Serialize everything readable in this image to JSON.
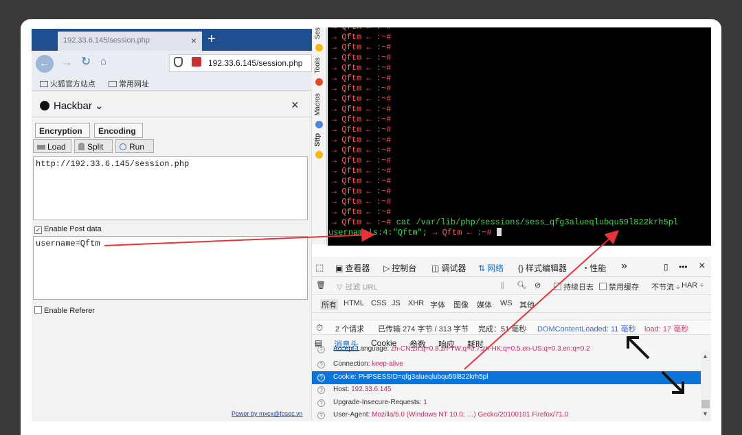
{
  "browser": {
    "tab_title": "192.33.6.145/session.php",
    "tab_close": "×",
    "new_tab": "+",
    "url": "192.33.6.145/session.php",
    "bookmarks": [
      "火狐官方站点",
      "常用网址"
    ]
  },
  "hackbar": {
    "title": "Hackbar",
    "title_caret": "⌄",
    "close": "×",
    "dropdowns": [
      "Encryption",
      "Encoding"
    ],
    "buttons": [
      "Load",
      "Split",
      "Run"
    ],
    "url_value": "http://192.33.6.145/session.php",
    "post_checkbox_label": "Enable Post data",
    "post_value": "username=Qftm",
    "referer_checkbox_label": "Enable Referer",
    "footer": "Power by mxcx@fosec.vn"
  },
  "sidebar": {
    "tabs": [
      "Ses",
      "Tools",
      "Macros",
      "Sttp"
    ]
  },
  "terminal": {
    "prompt_user": "Qftm",
    "prompt_arrow": "→",
    "prompt_tail": "← :~#",
    "repeated_prompt_count": 19,
    "command": "cat /var/lib/php/sessions/sess_qfg3alueqlubqu59l822krh5pl",
    "output": "username|s:4:\"Qftm\";",
    "final_prompt": "→ Qftm ← :~#"
  },
  "devtools": {
    "toolbar": [
      "查看器",
      "控制台",
      "调试器",
      "网络",
      "样式编辑器",
      "性能"
    ],
    "active_tool": "网络",
    "more": "»",
    "filter_placeholder": "过滤 URL",
    "persist_log": "持续日志",
    "disable_cache": "禁用缓存",
    "throttle": "不节流 ÷",
    "har": "HAR ÷",
    "type_filters": [
      "所有",
      "HTML",
      "CSS",
      "JS",
      "XHR",
      "字体",
      "图像",
      "媒体",
      "WS",
      "其他"
    ],
    "status": {
      "requests": "2 个请求",
      "transferred": "已传输 274 字节 / 313 字节",
      "finish": "完成：51 毫秒",
      "dom_loaded": "DOMContentLoaded: 11 毫秒",
      "load": "load: 17 毫秒"
    },
    "subtabs": [
      "消息头",
      "Cookie",
      "参数",
      "响应",
      "耗时"
    ],
    "active_subtab": "消息头",
    "headers": [
      {
        "name": "Accept-Language:",
        "value": "zh-CN,zh;q=0.8,zh-TW;q=0.7,zh-HK;q=0.5,en-US;q=0.3,en;q=0.2",
        "selected": false
      },
      {
        "name": "Connection:",
        "value": "keep-alive",
        "selected": false
      },
      {
        "name": "Cookie:",
        "value": "PHPSESSID=qfg3alueqlubqu59l822krh5pl",
        "selected": true
      },
      {
        "name": "Host:",
        "value": "192.33.6.145",
        "selected": false
      },
      {
        "name": "Upgrade-Insecure-Requests:",
        "value": "1",
        "selected": false
      },
      {
        "name": "User-Agent:",
        "value": "Mozilla/5.0 (Windows NT 10.0; …) Gecko/20100101 Firefox/71.0",
        "selected": false
      }
    ]
  },
  "colors": {
    "annotation_arrow": "#e8333a",
    "terminal_prompt": "#ff5a5a",
    "terminal_text": "#3bdc48",
    "selected_row": "#0a74d8"
  }
}
